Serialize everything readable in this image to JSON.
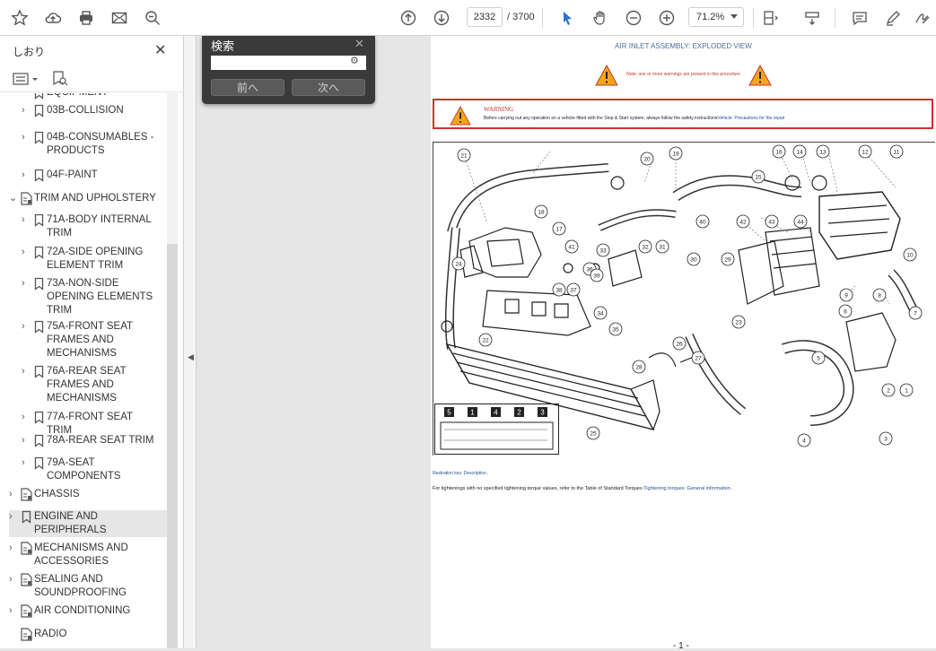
{
  "toolbar": {
    "current_page": "2332",
    "total_pages": "/ 3700",
    "zoom": "71.2%"
  },
  "sidebar": {
    "title": "しおり",
    "tree": [
      {
        "label": "EQUIPMENT",
        "level": 1,
        "type": "bookmark",
        "expand": ""
      },
      {
        "label": "03B-COLLISION",
        "level": 1,
        "type": "bookmark",
        "expand": "›"
      },
      {
        "label": "04B-CONSUMABLES - PRODUCTS",
        "level": 1,
        "type": "bookmark",
        "expand": "›"
      },
      {
        "label": "04F-PAINT",
        "level": 1,
        "type": "bookmark",
        "expand": "›"
      },
      {
        "label": "TRIM AND UPHOLSTERY",
        "level": 0,
        "type": "doc",
        "expand": "⌄"
      },
      {
        "label": "71A-BODY INTERNAL TRIM",
        "level": 1,
        "type": "bookmark",
        "expand": "›"
      },
      {
        "label": "72A-SIDE OPENING ELEMENT TRIM",
        "level": 1,
        "type": "bookmark",
        "expand": "›"
      },
      {
        "label": "73A-NON-SIDE OPENING ELEMENTS TRIM",
        "level": 1,
        "type": "bookmark",
        "expand": "›"
      },
      {
        "label": "75A-FRONT SEAT FRAMES AND MECHANISMS",
        "level": 1,
        "type": "bookmark",
        "expand": "›"
      },
      {
        "label": "76A-REAR SEAT FRAMES AND MECHANISMS",
        "level": 1,
        "type": "bookmark",
        "expand": "›"
      },
      {
        "label": "77A-FRONT SEAT TRIM",
        "level": 1,
        "type": "bookmark",
        "expand": "›"
      },
      {
        "label": "78A-REAR SEAT TRIM",
        "level": 1,
        "type": "bookmark",
        "expand": "›"
      },
      {
        "label": "79A-SEAT COMPONENTS",
        "level": 1,
        "type": "bookmark",
        "expand": "›"
      },
      {
        "label": "CHASSIS",
        "level": 0,
        "type": "doc",
        "expand": "›"
      },
      {
        "label": "ENGINE AND PERIPHERALS",
        "level": 0,
        "type": "bookmark",
        "expand": "›"
      },
      {
        "label": "MECHANISMS AND ACCESSORIES",
        "level": 0,
        "type": "doc",
        "expand": "›"
      },
      {
        "label": "SEALING AND SOUNDPROOFING",
        "level": 0,
        "type": "doc",
        "expand": "›"
      },
      {
        "label": "AIR CONDITIONING",
        "level": 0,
        "type": "doc",
        "expand": "›"
      },
      {
        "label": "RADIO",
        "level": 0,
        "type": "doc",
        "expand": ""
      }
    ]
  },
  "search": {
    "title": "検索",
    "prev": "前へ",
    "next": "次へ"
  },
  "document": {
    "title": "AIR INLET ASSEMBLY: EXPLODED VIEW",
    "note": "Note: one or more warnings are present in this procedure",
    "warning_title": "WARNING",
    "warning_text": "Before carrying out any operation on a vehicle fitted with the Stop & Start system, always follow the safety instructions",
    "warning_link": "Vehicle: Precautions for the repair",
    "illustration_key": "Illustration key: Description .",
    "tightening": "For tightenings with no specified tightening torque values, refer to the Table of Standard Torques",
    "tightening_link": "Tightening torques: General information .",
    "page_number": "- 1 -",
    "callouts": [
      "21",
      "20",
      "19",
      "18",
      "16",
      "14",
      "13",
      "12",
      "11",
      "24",
      "17",
      "15",
      "42",
      "43",
      "44",
      "10",
      "40",
      "41",
      "33",
      "32",
      "31",
      "30",
      "29",
      "38",
      "37",
      "36",
      "35",
      "34",
      "39",
      "23",
      "22",
      "28",
      "27",
      "26",
      "25",
      "9",
      "8",
      "7",
      "6",
      "5",
      "4",
      "3",
      "2",
      "1"
    ],
    "inset_labels": [
      "5",
      "1",
      "4",
      "2",
      "3"
    ]
  },
  "colors": {
    "warning_red": "#d32f2f",
    "link_blue": "#1f4e9a",
    "search_bg": "#3a3a3a"
  }
}
